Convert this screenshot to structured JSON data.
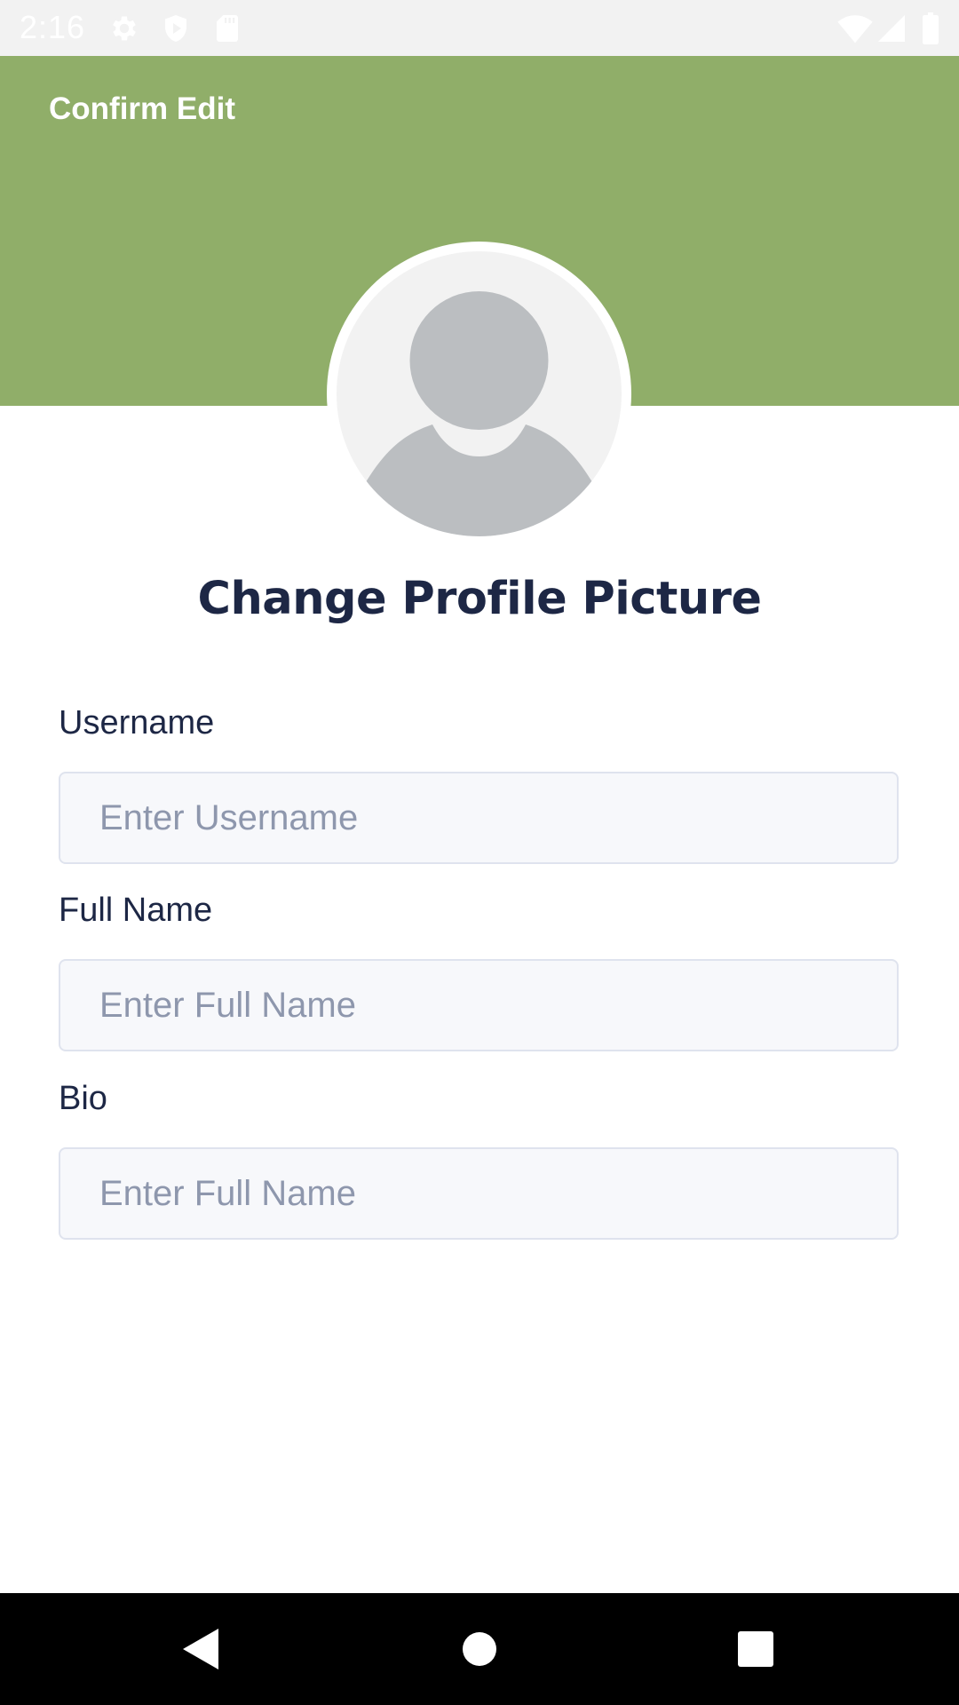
{
  "status_bar": {
    "time": "2:16",
    "icons": [
      "gear-icon",
      "shield-play-icon",
      "sd-card-icon",
      "wifi-icon",
      "signal-icon",
      "battery-icon"
    ]
  },
  "header": {
    "action_label": "Confirm Edit",
    "background_color": "#90ae69"
  },
  "profile": {
    "change_picture_label": "Change Profile Picture"
  },
  "form": {
    "fields": [
      {
        "label": "Username",
        "placeholder": "Enter Username",
        "value": ""
      },
      {
        "label": "Full Name",
        "placeholder": "Enter Full Name",
        "value": ""
      },
      {
        "label": "Bio",
        "placeholder": "Enter Full Name",
        "value": ""
      }
    ]
  },
  "nav_bar": {
    "buttons": [
      "back-icon",
      "home-icon",
      "recents-icon"
    ]
  }
}
